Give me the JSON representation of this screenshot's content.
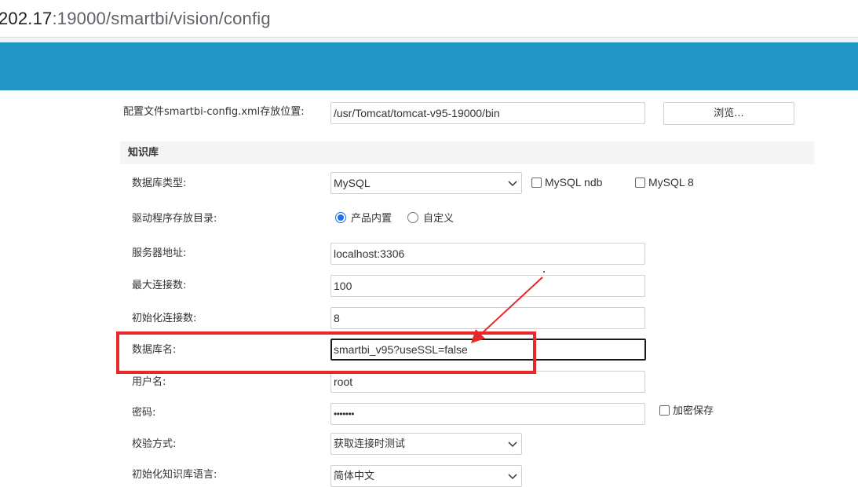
{
  "browser": {
    "url_host": "202.17",
    "url_path": ":19000/smartbi/vision/config"
  },
  "config": {
    "file_label": "配置文件smartbi-config.xml存放位置:",
    "file_path": "/usr/Tomcat/tomcat-v95-19000/bin",
    "browse_label": "浏览..."
  },
  "knowledge_base": {
    "section_title": "知识库",
    "db_type": {
      "label": "数据库类型:",
      "value": "MySQL",
      "checkbox_ndb": "MySQL ndb",
      "checkbox_8": "MySQL 8"
    },
    "driver_dir": {
      "label": "驱动程序存放目录:",
      "option_builtin": "产品内置",
      "option_custom": "自定义"
    },
    "server": {
      "label": "服务器地址:",
      "value": "localhost:3306"
    },
    "max_conn": {
      "label": "最大连接数:",
      "value": "100"
    },
    "init_conn": {
      "label": "初始化连接数:",
      "value": "8"
    },
    "db_name": {
      "label": "数据库名:",
      "value": "smartbi_v95?useSSL=false"
    },
    "username": {
      "label": "用户名:",
      "value": "root"
    },
    "password": {
      "label": "密码:",
      "value": "•••••••",
      "encrypt_label": "加密保存"
    },
    "validate": {
      "label": "校验方式:",
      "value": "获取连接时测试"
    },
    "init_lang": {
      "label": "初始化知识库语言:",
      "value": "简体中文"
    }
  },
  "colors": {
    "app_bar": "#2196c4",
    "highlight": "#e8262b"
  }
}
